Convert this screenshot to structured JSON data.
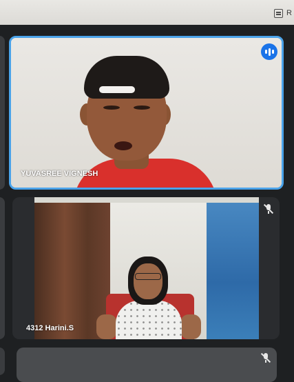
{
  "window": {
    "top_label": "R",
    "top_icon": "reading-mode-icon"
  },
  "participants": [
    {
      "name": "YUVASREE VIGNESH",
      "state": "speaking",
      "indicator_icon": "speaking-indicator-icon",
      "active_border_color": "#4aa3ea"
    },
    {
      "name": "4312 Harini.S",
      "state": "muted",
      "indicator_icon": "mic-off-icon"
    },
    {
      "name": "",
      "state": "muted",
      "indicator_icon": "mic-off-icon"
    }
  ],
  "colors": {
    "background": "#1e2022",
    "accent": "#1a73e8"
  }
}
